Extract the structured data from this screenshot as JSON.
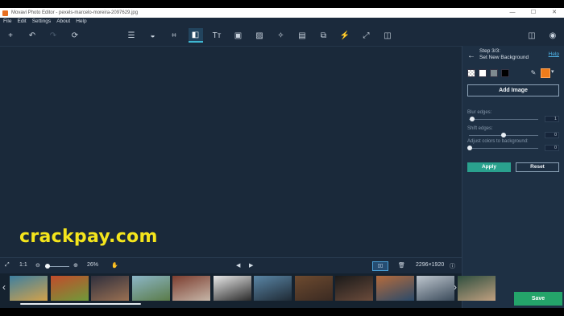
{
  "window": {
    "title": "Movavi Photo Editor - pexels-marcelo-moreira-2097629.jpg",
    "min": "—",
    "max": "☐",
    "close": "✕"
  },
  "menu": [
    "File",
    "Edit",
    "Settings",
    "About",
    "Help"
  ],
  "toolbar": {
    "left": [
      {
        "name": "add-icon",
        "glyph": "+"
      },
      {
        "name": "undo-icon",
        "glyph": "↶"
      },
      {
        "name": "redo-icon",
        "glyph": "↷"
      },
      {
        "name": "reset-icon",
        "glyph": "⟳"
      }
    ],
    "tools": [
      {
        "name": "adjust-icon",
        "glyph": "☰"
      },
      {
        "name": "enhance-icon",
        "glyph": "◒"
      },
      {
        "name": "crop-icon",
        "glyph": "⌗"
      },
      {
        "name": "background-icon",
        "glyph": "◧",
        "active": true
      },
      {
        "name": "text-icon",
        "glyph": "Tт"
      },
      {
        "name": "frame-icon",
        "glyph": "▣"
      },
      {
        "name": "filter-icon",
        "glyph": "▨"
      },
      {
        "name": "retouch-icon",
        "glyph": "✧"
      },
      {
        "name": "image-icon",
        "glyph": "▤"
      },
      {
        "name": "clone-icon",
        "glyph": "⧉"
      },
      {
        "name": "magic-icon",
        "glyph": "⚡"
      },
      {
        "name": "resize-icon",
        "glyph": "⤢"
      },
      {
        "name": "split-icon",
        "glyph": "◫"
      }
    ],
    "right": [
      {
        "name": "compare-view-icon",
        "glyph": "◫"
      },
      {
        "name": "preview-eye-icon",
        "glyph": "◉"
      }
    ]
  },
  "watermark": "crackpay.com",
  "panel": {
    "back": "←",
    "step_title": "Step 3/3:",
    "step_subtitle": "Set New Background",
    "help": "Help",
    "swatch_colors": [
      "transparent",
      "#ffffff",
      "#7f8a8f",
      "#000000"
    ],
    "picker": "✎",
    "selected_color": "#ef7c1b",
    "dropdown": "▾",
    "add_image": "Add Image",
    "blur_label": "Blur edges:",
    "blur_value": "1",
    "shift_label": "Shift edges:",
    "shift_value": "0",
    "adjust_label": "Adjust colors to background:",
    "adjust_value": "0",
    "apply": "Apply",
    "reset": "Reset",
    "save": "Save"
  },
  "bottombar": {
    "fit": "⤢",
    "one_to_one": "1:1",
    "zoom_out": "⊖",
    "zoom_in": "⊕",
    "zoom": "26%",
    "hand": "✋",
    "prev": "◀",
    "next": "▶",
    "compare": "▯▯",
    "trash": "🗑",
    "dimensions": "2296×1920",
    "info": "ⓘ"
  },
  "filmstrip": {
    "prev": "‹",
    "next": "›",
    "thumbs": [
      {
        "name": "thumb-1",
        "colors": [
          "#3d7fa0",
          "#d3a24a"
        ]
      },
      {
        "name": "thumb-2",
        "colors": [
          "#c24b2b",
          "#6f9b3a"
        ]
      },
      {
        "name": "thumb-3",
        "colors": [
          "#2f2f3d",
          "#9a7052"
        ]
      },
      {
        "name": "thumb-4",
        "colors": [
          "#8cb6c8",
          "#5a7b48"
        ]
      },
      {
        "name": "thumb-5",
        "colors": [
          "#7c3d2f",
          "#c6b6a8"
        ]
      },
      {
        "name": "thumb-6",
        "colors": [
          "#e8e8e8",
          "#2a2a2a"
        ]
      },
      {
        "name": "thumb-7",
        "colors": [
          "#5a86a6",
          "#1f2a35"
        ]
      },
      {
        "name": "thumb-8",
        "colors": [
          "#6d4a2f",
          "#3a2a22"
        ]
      },
      {
        "name": "thumb-9",
        "colors": [
          "#1a1a1a",
          "#6b4b3b"
        ]
      },
      {
        "name": "thumb-10",
        "colors": [
          "#b66b3b",
          "#2a4a6a"
        ]
      },
      {
        "name": "thumb-11",
        "colors": [
          "#bfc7cf",
          "#3a4a5a"
        ]
      },
      {
        "name": "thumb-12",
        "colors": [
          "#2f4f3f",
          "#c0a080"
        ]
      }
    ]
  }
}
